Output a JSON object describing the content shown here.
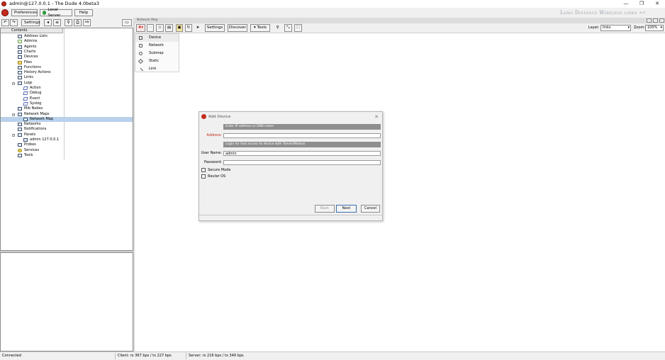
{
  "window": {
    "title": "admin@127.0.0.1 - The Dude 4.0beta3",
    "controls": [
      "—",
      "❐",
      "✕"
    ]
  },
  "menubar": {
    "preferences": "Preferences",
    "local_server": "Local Server",
    "help": "Help",
    "brand": "Long Distance Wireless links »»"
  },
  "left_toolbar": {
    "settings": "Settings",
    "syslog_btn": "sw"
  },
  "tree": {
    "header": "Contents",
    "items": [
      {
        "label": "Address Lists",
        "indent": 1,
        "icon": "list-icon"
      },
      {
        "label": "Admins",
        "indent": 1,
        "icon": "admin-icon"
      },
      {
        "label": "Agents",
        "indent": 1,
        "icon": "list-icon"
      },
      {
        "label": "Charts",
        "indent": 1,
        "icon": "list-icon"
      },
      {
        "label": "Devices",
        "indent": 1,
        "icon": "list-icon"
      },
      {
        "label": "Files",
        "indent": 1,
        "icon": "folder-icon"
      },
      {
        "label": "Functions",
        "indent": 1,
        "icon": "list-icon"
      },
      {
        "label": "History Actions",
        "indent": 1,
        "icon": "list-icon"
      },
      {
        "label": "Links",
        "indent": 1,
        "icon": "list-icon"
      },
      {
        "label": "Logs",
        "indent": 1,
        "icon": "list-icon",
        "expand": "−"
      },
      {
        "label": "Action",
        "indent": 2,
        "icon": "log-icon"
      },
      {
        "label": "Debug",
        "indent": 2,
        "icon": "log-icon"
      },
      {
        "label": "Event",
        "indent": 2,
        "icon": "log-icon"
      },
      {
        "label": "Syslog",
        "indent": 2,
        "icon": "log-icon"
      },
      {
        "label": "Mib Nodes",
        "indent": 1,
        "icon": "list-icon"
      },
      {
        "label": "Network Maps",
        "indent": 1,
        "icon": "list-icon",
        "expand": "−"
      },
      {
        "label": "Network Map",
        "indent": 2,
        "icon": "map-icon",
        "selected": true
      },
      {
        "label": "Networks",
        "indent": 1,
        "icon": "list-icon"
      },
      {
        "label": "Notifications",
        "indent": 1,
        "icon": "list-icon"
      },
      {
        "label": "Panels",
        "indent": 1,
        "icon": "list-icon",
        "expand": "−"
      },
      {
        "label": "admin 127.0.0.1",
        "indent": 2,
        "icon": "list-icon"
      },
      {
        "label": "Probes",
        "indent": 1,
        "icon": "list-icon"
      },
      {
        "label": "Services",
        "indent": 1,
        "icon": "gear-icon"
      },
      {
        "label": "Tools",
        "indent": 1,
        "icon": "list-icon"
      }
    ]
  },
  "map": {
    "tab_title": "Network Map",
    "toolbar": {
      "settings": "Settings",
      "discover": "Discover",
      "tools": "▾ Tools",
      "layer_label": "Layer:",
      "layer_value": "links",
      "zoom_label": "Zoom:",
      "zoom_value": "100%"
    },
    "add_menu": [
      {
        "label": "Device",
        "icon": "device-icon",
        "highlighted": true
      },
      {
        "label": "Network",
        "icon": "network-icon"
      },
      {
        "label": "Submap",
        "icon": "submap-icon"
      },
      {
        "label": "Static",
        "icon": "static-icon"
      },
      {
        "label": "Link",
        "icon": "link-icon"
      }
    ]
  },
  "dialog": {
    "title": "Add Device",
    "close": "✕",
    "address_hint": "Enter IP address or DNS name",
    "address_label": "Address:",
    "address_value": "",
    "login_hint": "Login for fast access to device with Telnet/Winbox",
    "username_label": "User Name:",
    "username_value": "admin",
    "password_label": "Password:",
    "password_value": "",
    "secure_mode": "Secure Mode",
    "router_os": "Router OS",
    "back": "Back",
    "next": "Next",
    "cancel": "Cancel"
  },
  "status": {
    "left": "Connected",
    "client": "Client: rx 367 bps / tx 227 bps",
    "server": "Server: rx 216 bps / tx 349 bps"
  },
  "colors": {
    "selection": "#b9d1ea",
    "hint_bg": "#8e8e8e",
    "accent_red": "#c42b1c"
  }
}
